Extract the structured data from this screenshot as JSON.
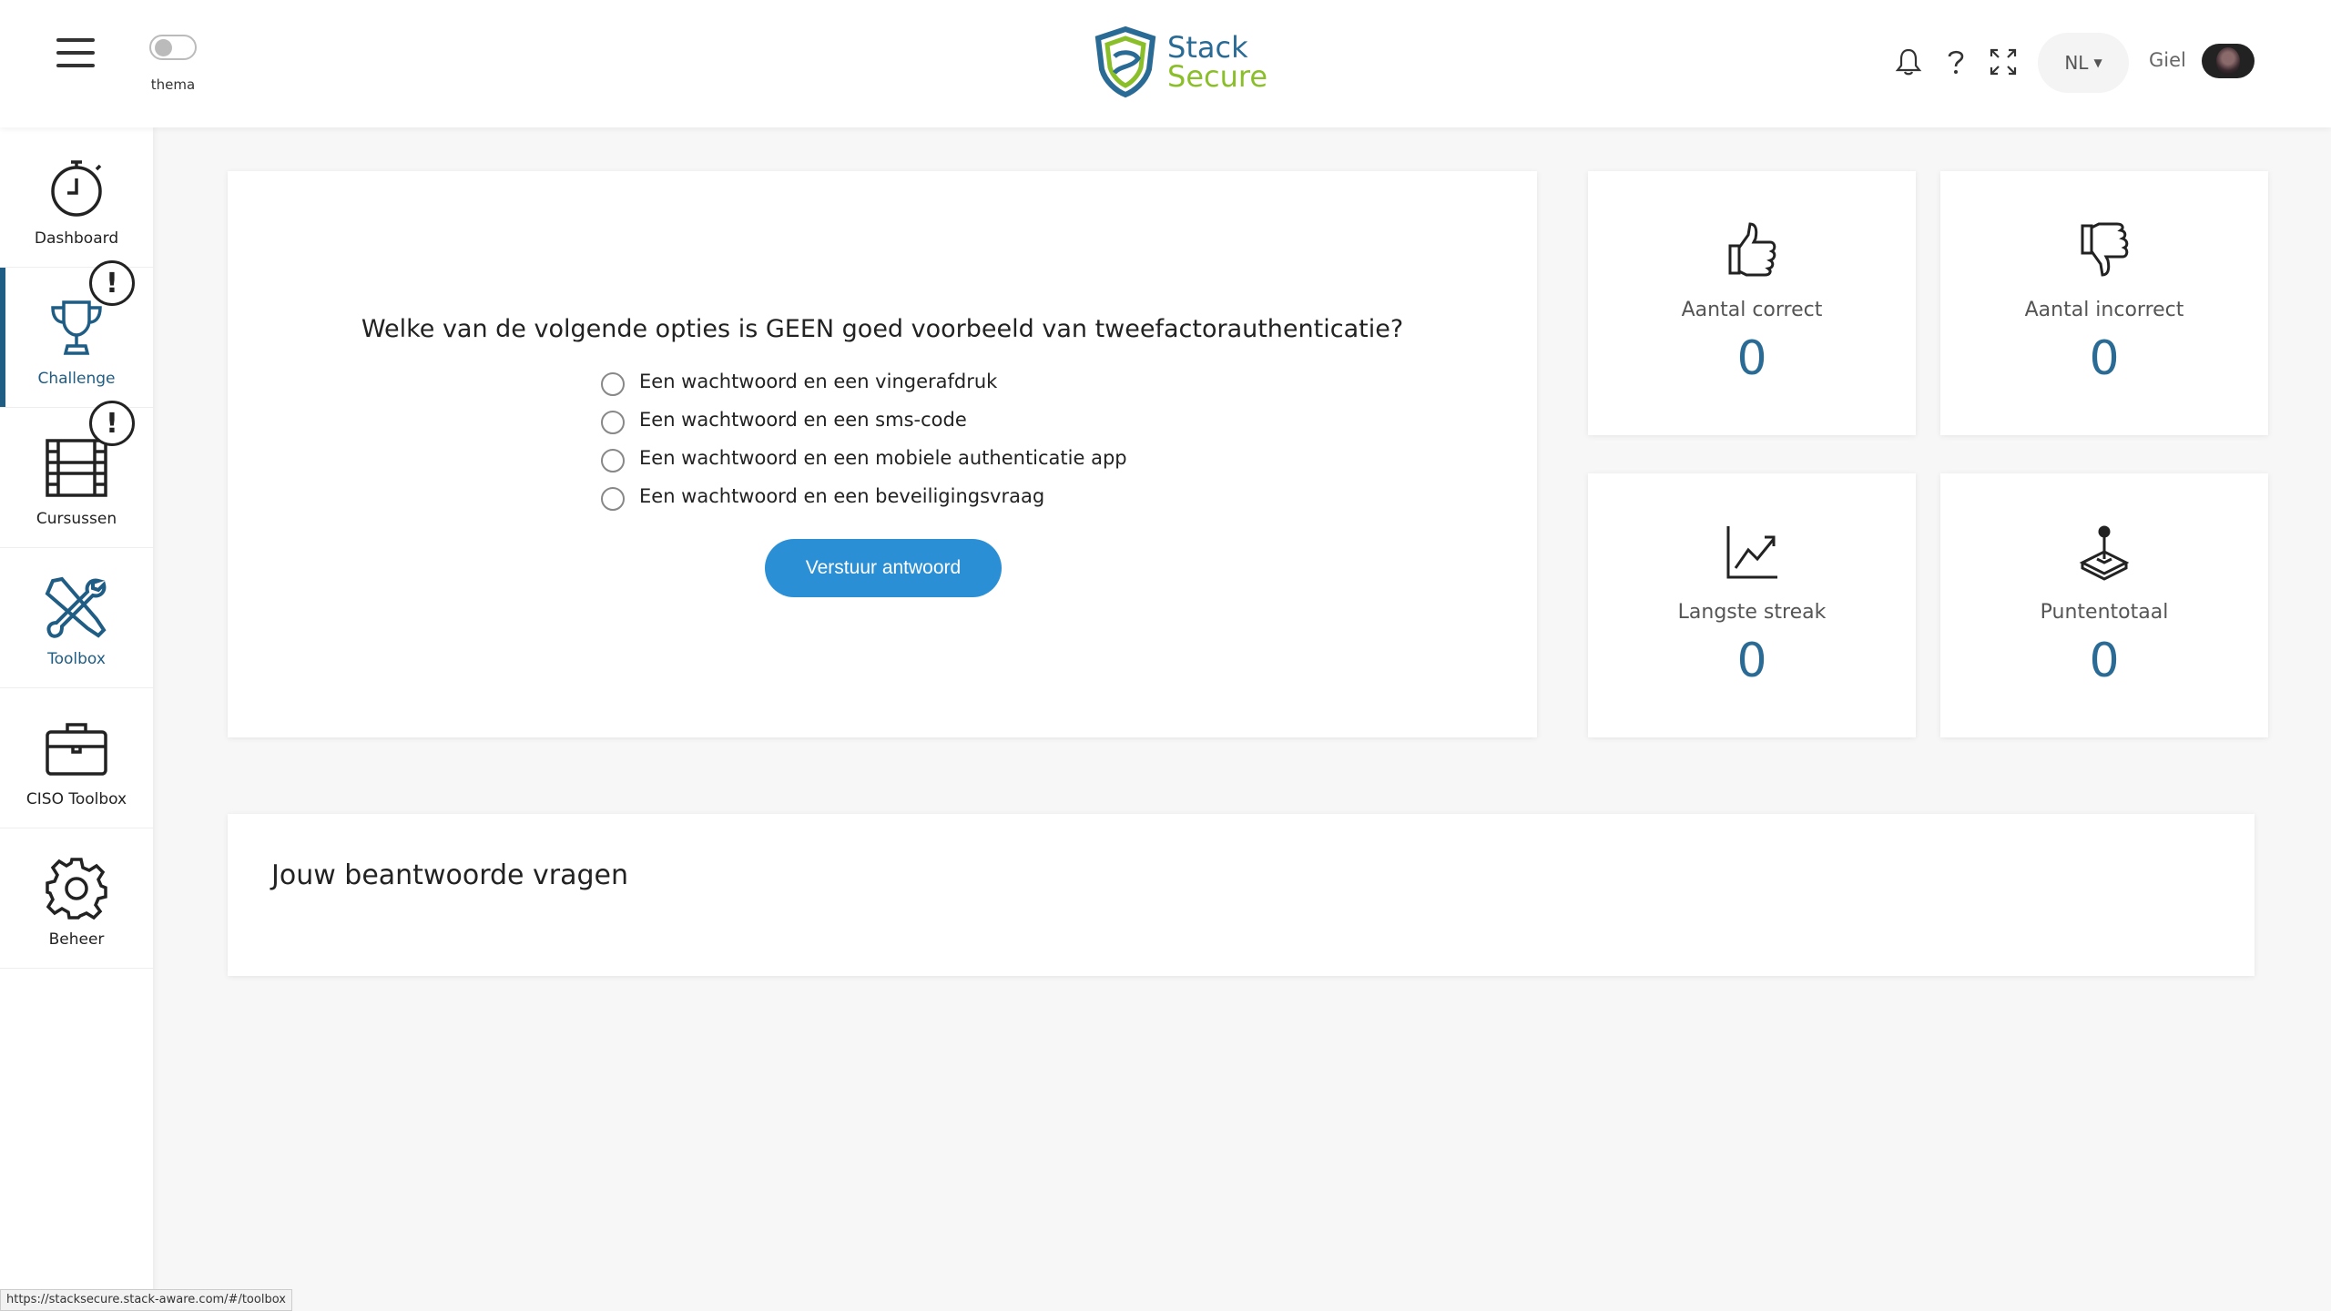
{
  "topbar": {
    "theme_label": "thema",
    "logo": {
      "line1": "Stack",
      "line2": "Secure"
    },
    "language": "NL",
    "user_name": "Giel"
  },
  "sidebar": {
    "items": [
      {
        "label": "Dashboard",
        "icon": "stopwatch-icon"
      },
      {
        "label": "Challenge",
        "icon": "trophy-icon",
        "badge": "!"
      },
      {
        "label": "Cursussen",
        "icon": "film-icon",
        "badge": "!"
      },
      {
        "label": "Toolbox",
        "icon": "tools-icon"
      },
      {
        "label": "CISO Toolbox",
        "icon": "briefcase-icon"
      },
      {
        "label": "Beheer",
        "icon": "gear-icon"
      }
    ]
  },
  "question": {
    "text": "Welke van de volgende opties is GEEN goed voorbeeld van tweefactorauthenticatie?",
    "options": [
      "Een wachtwoord en een vingerafdruk",
      "Een wachtwoord en een sms-code",
      "Een wachtwoord en een mobiele authenticatie app",
      "Een wachtwoord en een beveiligingsvraag"
    ],
    "submit_label": "Verstuur antwoord"
  },
  "stats": [
    {
      "label": "Aantal correct",
      "value": "0",
      "icon": "thumbs-up-icon"
    },
    {
      "label": "Aantal incorrect",
      "value": "0",
      "icon": "thumbs-down-icon"
    },
    {
      "label": "Langste streak",
      "value": "0",
      "icon": "line-chart-icon"
    },
    {
      "label": "Puntentotaal",
      "value": "0",
      "icon": "joystick-icon"
    }
  ],
  "answered": {
    "title": "Jouw beantwoorde vragen"
  },
  "status_url": "https://stacksecure.stack-aware.com/#/toolbox",
  "colors": {
    "accent": "#2b8fd6",
    "brand_blue": "#2a6b96",
    "brand_green": "#8bbf2a",
    "active": "#1f5d85"
  }
}
